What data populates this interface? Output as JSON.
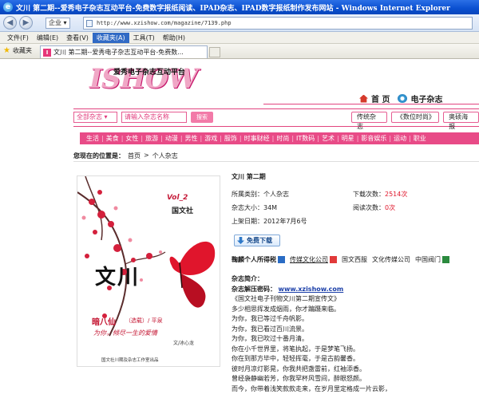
{
  "window": {
    "title": "文川 第二期--爱秀电子杂志互动平台-免费数字报纸阅读、IPAD杂志、IPAD数字报纸制作发布网站 - Windows Internet Explorer"
  },
  "address_bar": {
    "zone": "企业",
    "url": "http://www.xzishow.com/magazine/7139.php"
  },
  "menu": {
    "items": [
      {
        "label": "文件(F)"
      },
      {
        "label": "编辑(E)"
      },
      {
        "label": "查看(V)"
      },
      {
        "label": "收藏夹(A)"
      },
      {
        "label": "工具(T)"
      },
      {
        "label": "帮助(H)"
      }
    ]
  },
  "favorites": {
    "label": "收藏夹",
    "tab_title": "文川 第二期--爱秀电子杂志互动平台-免费数..."
  },
  "site": {
    "logo_text": "ISHOW",
    "slogan": "爱秀电子杂志互动平台",
    "topnav": [
      {
        "label": "首 页"
      },
      {
        "label": "电子杂志"
      }
    ],
    "search": {
      "select": "全部杂志",
      "placeholder": "请输入杂志名称",
      "button": "搜索"
    },
    "hotlinks": [
      {
        "label": "传统杂志"
      },
      {
        "label": "《数位时尚》"
      },
      {
        "label": "奥硕海报"
      }
    ],
    "categories": [
      "生活",
      "美食",
      "女性",
      "旅游",
      "动漫",
      "男性",
      "游戏",
      "服饰",
      "时事财经",
      "时尚",
      "IT数码",
      "艺术",
      "明星",
      "影音娱乐",
      "运动",
      "职业"
    ],
    "breadcrumb": {
      "prefix": "您现在的位置是：",
      "home": "首页",
      "sep": ">",
      "current": "个人杂志"
    }
  },
  "magazine": {
    "title": "文川 第二期",
    "category_label": "所属类别：",
    "category": "个人杂志",
    "downloads_label": "下载次数：",
    "downloads": "2514次",
    "size_label": "杂志大小：",
    "size": "34M",
    "reads_label": "阅读次数：",
    "reads": "0次",
    "date_label": "上架日期：",
    "date": "2012年7月6号",
    "download_button": "免费下载",
    "share": [
      {
        "label": "鞠麟个人所得税"
      },
      {
        "label": "传媒文化公司"
      },
      {
        "label": "国文西服"
      },
      {
        "label": "文化传媒公司"
      },
      {
        "label": "中国阀门"
      }
    ],
    "cover": {
      "vol": "Vol_2",
      "publisher": "国文社",
      "big_title": "文川",
      "subtitle": "暗八仙",
      "subtitle_note": "（选载）/ 平泉",
      "tagline": "为你，倾尽一生的爱情",
      "author": "文/冰心龙",
      "footer": "国文社川期及杂志工作室出品"
    },
    "intro": {
      "heading": "杂志简介：",
      "password_label": "杂志解压密码：",
      "password": "www.xzishow.com",
      "lines": [
        "《国文社电子刊物文川第二期宣传文》",
        "多少相思挥发成烟雨，你才蹁蹑来临。",
        "为你，我已等过千舟帆影。",
        "为你，我已看过百川流景。",
        "为你，我已吹过十番月清。",
        "你在小千世界里，将笔执起，于是梦笔飞扬。",
        "你在到那方毕中，轻轻挥毫，于是古韵馨香。",
        "彼时月凉灯影晃，你我共把盏雷前，红袖添香。",
        "曾经袅静幽若芳，你我罕杯风雪间，醉眼怒颜。",
        "而今，你带着浅笑款款走来，在岁月里定格成一片云影，"
      ]
    }
  },
  "colors": {
    "accent_pink": "#e84b87",
    "red_value": "#e0162b",
    "titlebar_blue": "#0a4fd0"
  }
}
